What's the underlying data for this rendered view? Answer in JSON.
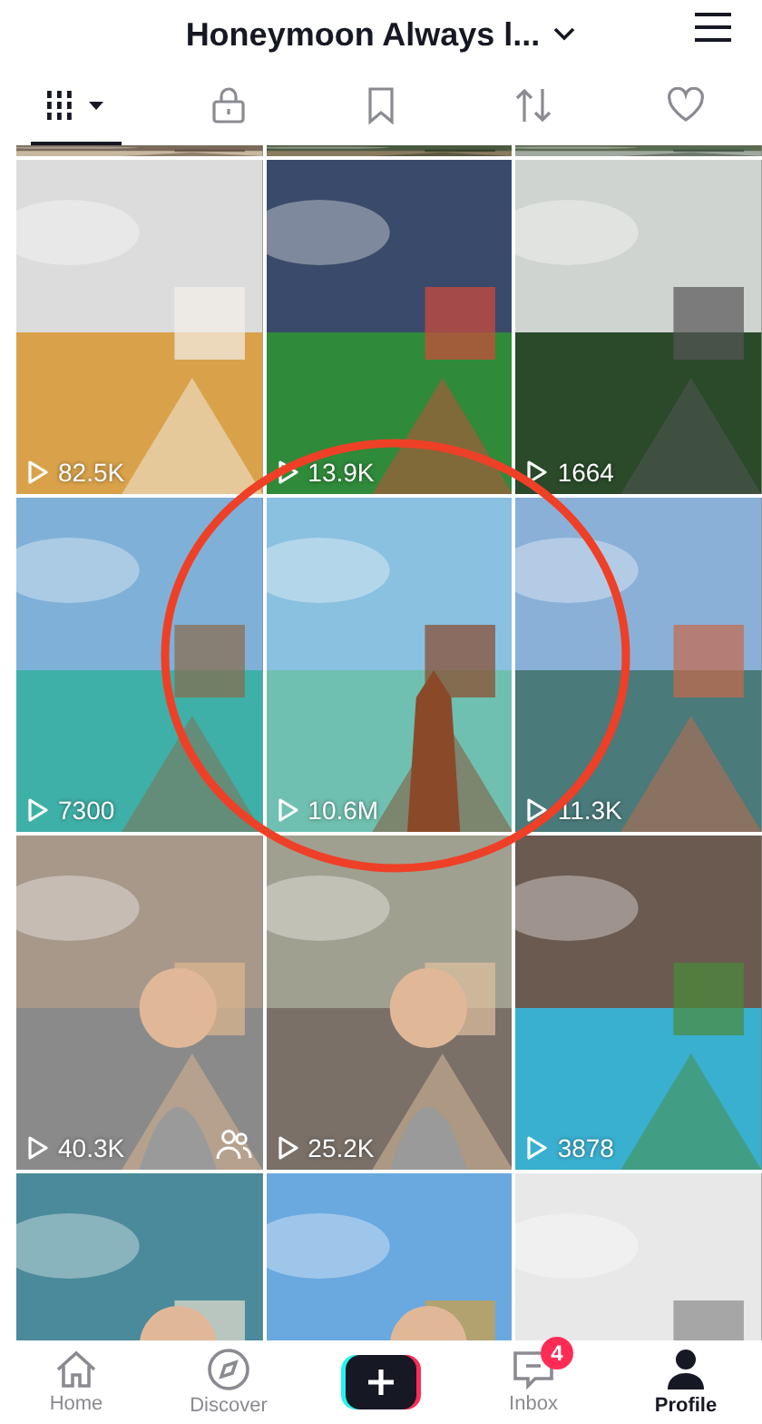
{
  "header": {
    "title": "Honeymoon Always l..."
  },
  "tabs": [
    {
      "selected": true
    },
    {
      "selected": false
    },
    {
      "selected": false
    },
    {
      "selected": false
    },
    {
      "selected": false
    }
  ],
  "videos": [
    {
      "kind": "picture"
    },
    {
      "kind": "picture"
    },
    {
      "kind": "picture"
    },
    {
      "kind": "picture",
      "views": "82.5K",
      "collab": false
    },
    {
      "kind": "picture",
      "views": "13.9K",
      "collab": false
    },
    {
      "kind": "picture",
      "views": "1664",
      "collab": false
    },
    {
      "kind": "picture",
      "views": "7300",
      "collab": false
    },
    {
      "kind": "picture",
      "views": "10.6M",
      "collab": false
    },
    {
      "kind": "picture",
      "views": "11.3K",
      "collab": false
    },
    {
      "kind": "picture",
      "views": "40.3K",
      "collab": true
    },
    {
      "kind": "picture",
      "views": "25.2K",
      "collab": false
    },
    {
      "kind": "picture",
      "views": "3878",
      "collab": false
    },
    {
      "kind": "picture"
    },
    {
      "kind": "picture"
    },
    {
      "kind": "picture"
    }
  ],
  "nav": [
    {
      "label": "Home",
      "selected": false
    },
    {
      "label": "Discover",
      "selected": false
    },
    {
      "kind": "create",
      "selected": false
    },
    {
      "label": "Inbox",
      "badge": "4",
      "selected": false
    },
    {
      "label": "Profile",
      "selected": true
    }
  ]
}
